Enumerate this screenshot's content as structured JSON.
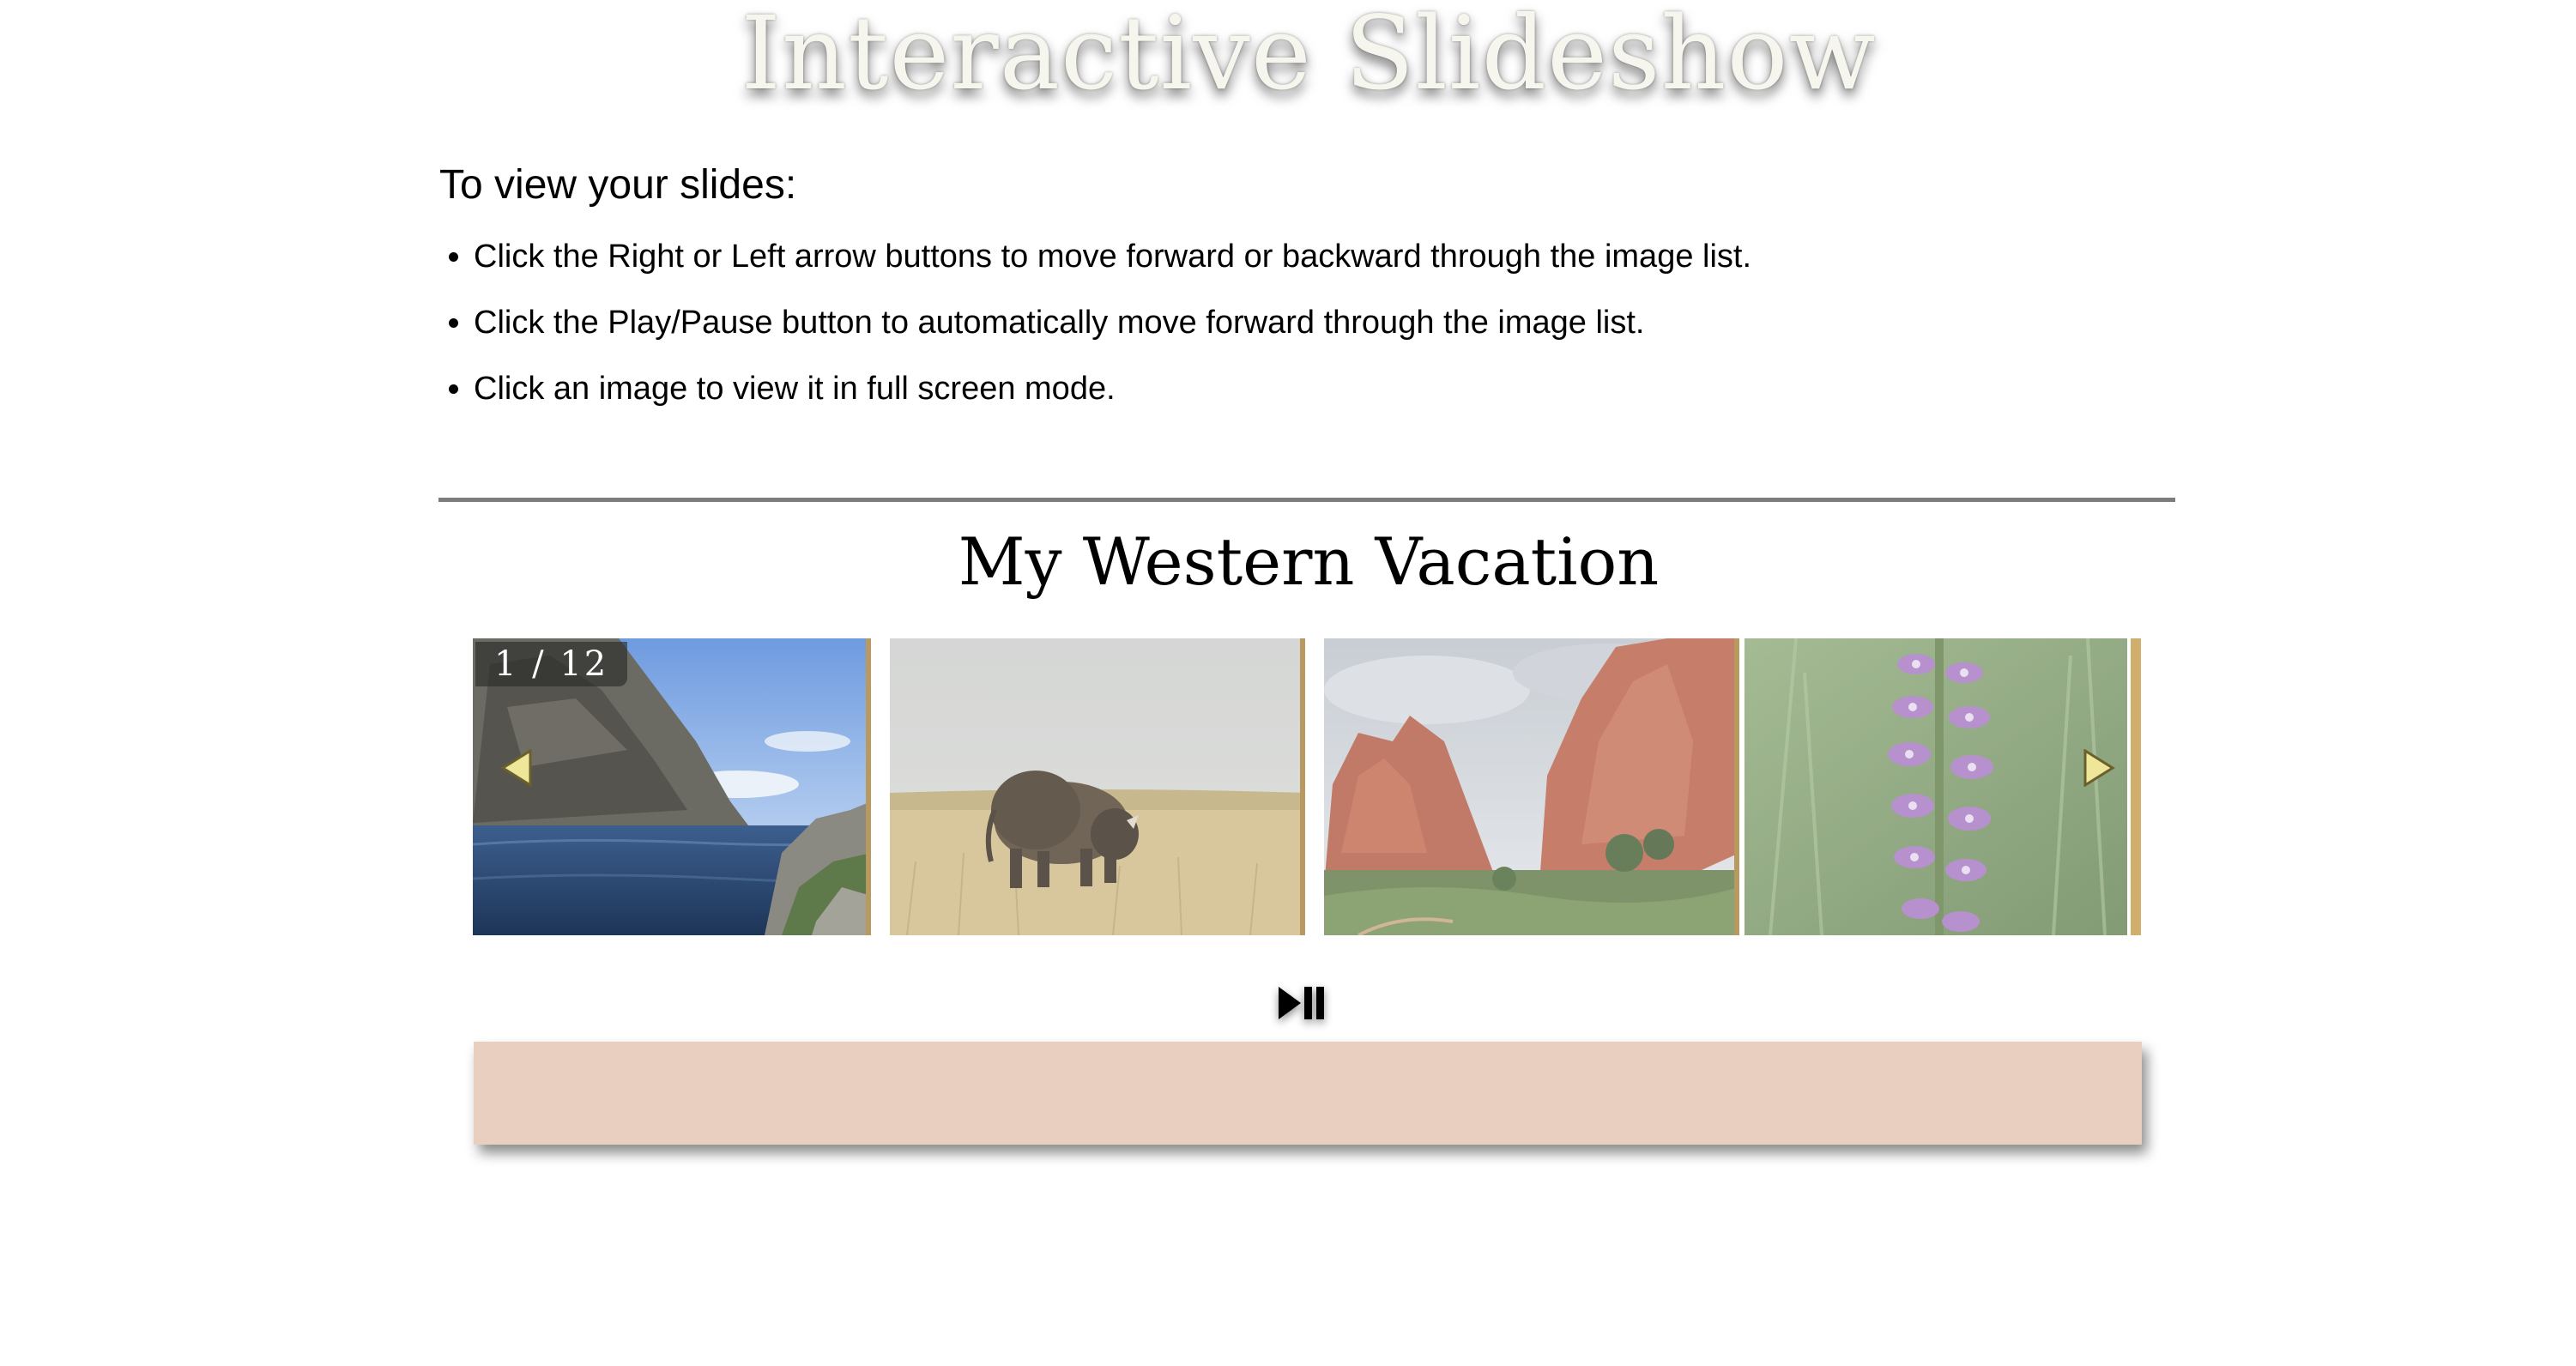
{
  "header": {
    "title": "Interactive Slideshow"
  },
  "instructions": {
    "heading": "To view your slides:",
    "items": [
      "Click the Right or Left arrow buttons to move forward or backward through the image list.",
      "Click the Play/Pause button to automatically move forward through the image list.",
      "Click an image to view it in full screen mode."
    ]
  },
  "slideshow": {
    "title": "My Western Vacation",
    "counter": "1 / 12",
    "caption": "",
    "slides": [
      {
        "subject": "mountain-lake"
      },
      {
        "subject": "bison-grassland"
      },
      {
        "subject": "red-rock-formations"
      },
      {
        "subject": "purple-wildflower"
      }
    ],
    "controls": {
      "prev_icon": "left-arrow-icon",
      "next_icon": "right-arrow-icon",
      "play_pause_icon": "play-pause-icon"
    }
  },
  "colors": {
    "title_text": "#f7f6ee",
    "divider": "#7d7d7d",
    "slide_border": "#b89a60",
    "arrow_fill": "#eee79a",
    "caption_background": "#e9cfbf"
  }
}
